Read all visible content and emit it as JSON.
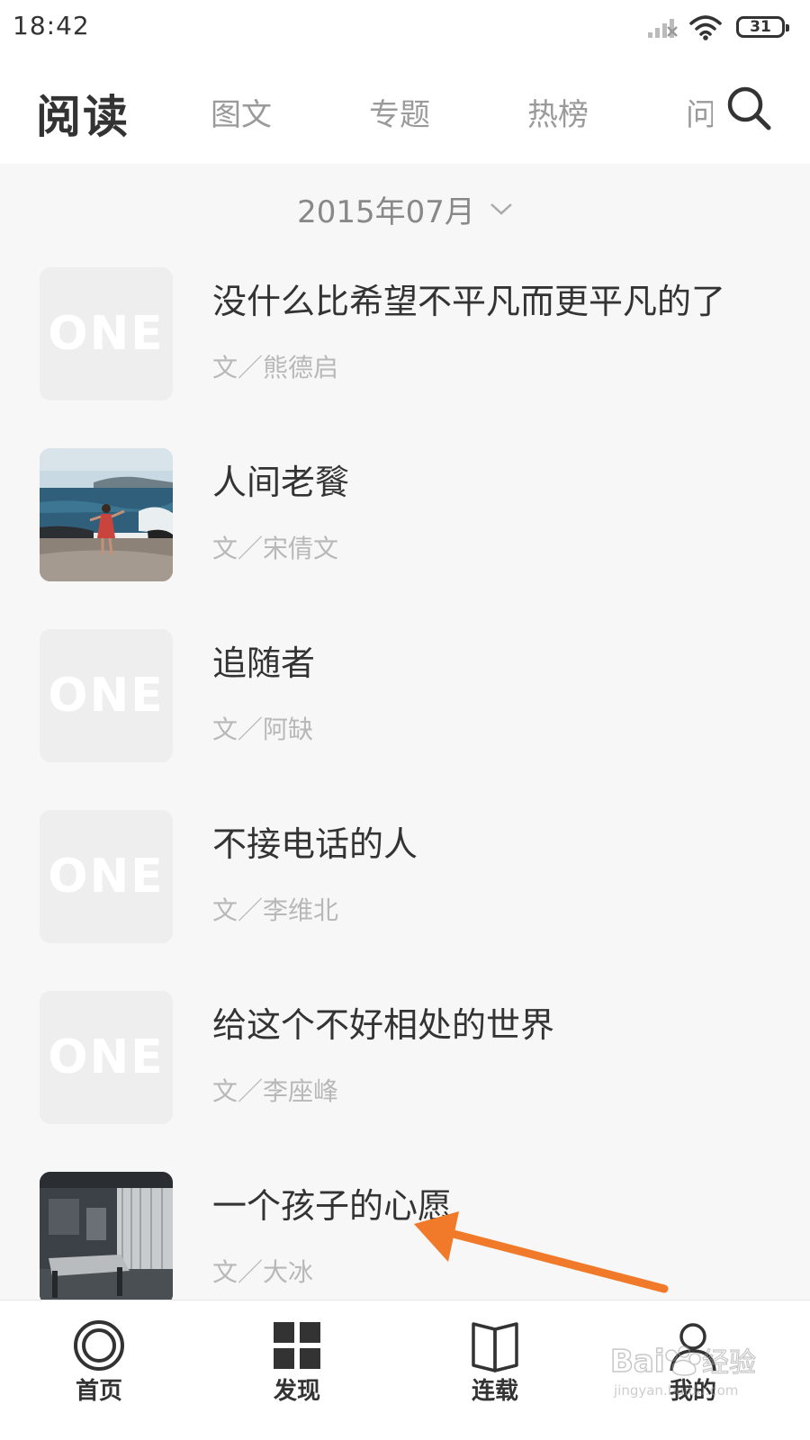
{
  "status_bar": {
    "time": "18:42",
    "battery": "31",
    "icons": [
      "signal-icon",
      "wifi-icon",
      "battery-icon"
    ]
  },
  "header": {
    "title": "阅读",
    "tabs": [
      {
        "label": "图文"
      },
      {
        "label": "专题"
      },
      {
        "label": "热榜"
      },
      {
        "label": "问"
      }
    ],
    "search_icon": "search-icon"
  },
  "date_selector": {
    "label": "2015年07月",
    "icon": "chevron-down-icon"
  },
  "articles": [
    {
      "title": "没什么比希望不平凡而更平凡的了",
      "author": "文／熊德启",
      "thumbnail": "one-logo-placeholder",
      "logo_text": "ONE"
    },
    {
      "title": "人间老餮",
      "author": "文／宋倩文",
      "thumbnail": "photo-girl-by-sea"
    },
    {
      "title": "追随者",
      "author": "文／阿缺",
      "thumbnail": "one-logo-placeholder",
      "logo_text": "ONE"
    },
    {
      "title": "不接电话的人",
      "author": "文／李维北",
      "thumbnail": "one-logo-placeholder",
      "logo_text": "ONE"
    },
    {
      "title": "给这个不好相处的世界",
      "author": "文／李座峰",
      "thumbnail": "one-logo-placeholder",
      "logo_text": "ONE"
    },
    {
      "title": "一个孩子的心愿",
      "author": "文／大冰",
      "thumbnail": "photo-hospital-room"
    }
  ],
  "annotation": {
    "color": "#f07a2a",
    "icon": "arrow-annotation"
  },
  "bottom_nav": [
    {
      "label": "首页",
      "icon": "home-icon"
    },
    {
      "label": "发现",
      "icon": "grid-icon"
    },
    {
      "label": "连载",
      "icon": "book-icon"
    },
    {
      "label": "我的",
      "icon": "profile-icon"
    }
  ],
  "watermark": {
    "text": "Bai经验",
    "subtext": "jingyan.baidu.com"
  }
}
